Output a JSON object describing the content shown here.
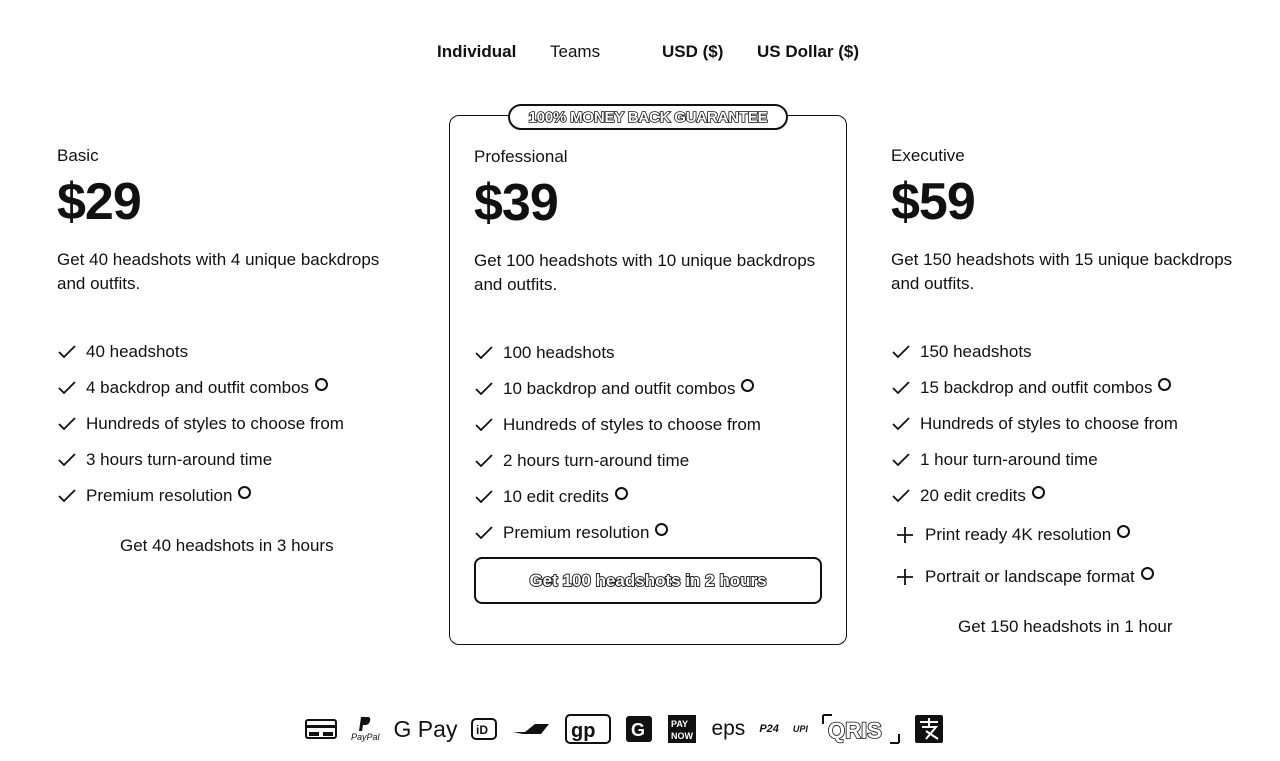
{
  "nav": {
    "individual": "Individual",
    "teams": "Teams",
    "currency_code": "USD ($)",
    "currency_name": "US Dollar ($)"
  },
  "plans": {
    "basic": {
      "name": "Basic",
      "price": "$29",
      "description": "Get 40 headshots with 4 unique backdrops and outfits.",
      "features": [
        "40 headshots",
        "4 backdrop and outfit combos",
        "Hundreds of styles to choose from",
        "3 hours turn-around time",
        "Premium resolution"
      ],
      "cta": "Get 40 headshots in 3 hours"
    },
    "professional": {
      "badge": "100% MONEY BACK GUARANTEE",
      "name": "Professional",
      "price": "$39",
      "description": "Get 100 headshots with 10 unique backdrops and outfits.",
      "features": [
        "100 headshots",
        "10 backdrop and outfit combos",
        "Hundreds of styles to choose from",
        "2 hours turn-around time",
        "10 edit credits",
        "Premium resolution"
      ],
      "cta": "Get 100 headshots in 2 hours"
    },
    "executive": {
      "name": "Executive",
      "price": "$59",
      "description": "Get 150 headshots with 15 unique backdrops and outfits.",
      "features": [
        "150 headshots",
        "15 backdrop and outfit combos",
        "Hundreds of styles to choose from",
        "1 hour turn-around time",
        "20 edit credits"
      ],
      "extras": [
        "Print ready 4K resolution",
        "Portrait or landscape format"
      ],
      "cta": "Get 150 headshots in 1 hour"
    }
  },
  "payments": {
    "paypal": "PayPal",
    "gpay": "G Pay",
    "eps": "eps",
    "p24": "P24",
    "giropay": "gp",
    "ideal": "iD",
    "payconiq": "PAY NOW",
    "qris": "QRIS",
    "upi": "UPI"
  },
  "icons": [
    "card-icon",
    "paypal-icon",
    "gpay-icon",
    "ideal-icon",
    "bancontact-icon",
    "giropay-icon",
    "grabpay-icon",
    "paynow-icon",
    "eps-icon",
    "p24-icon",
    "upi-icon",
    "qris-icon",
    "alipay-icon"
  ]
}
